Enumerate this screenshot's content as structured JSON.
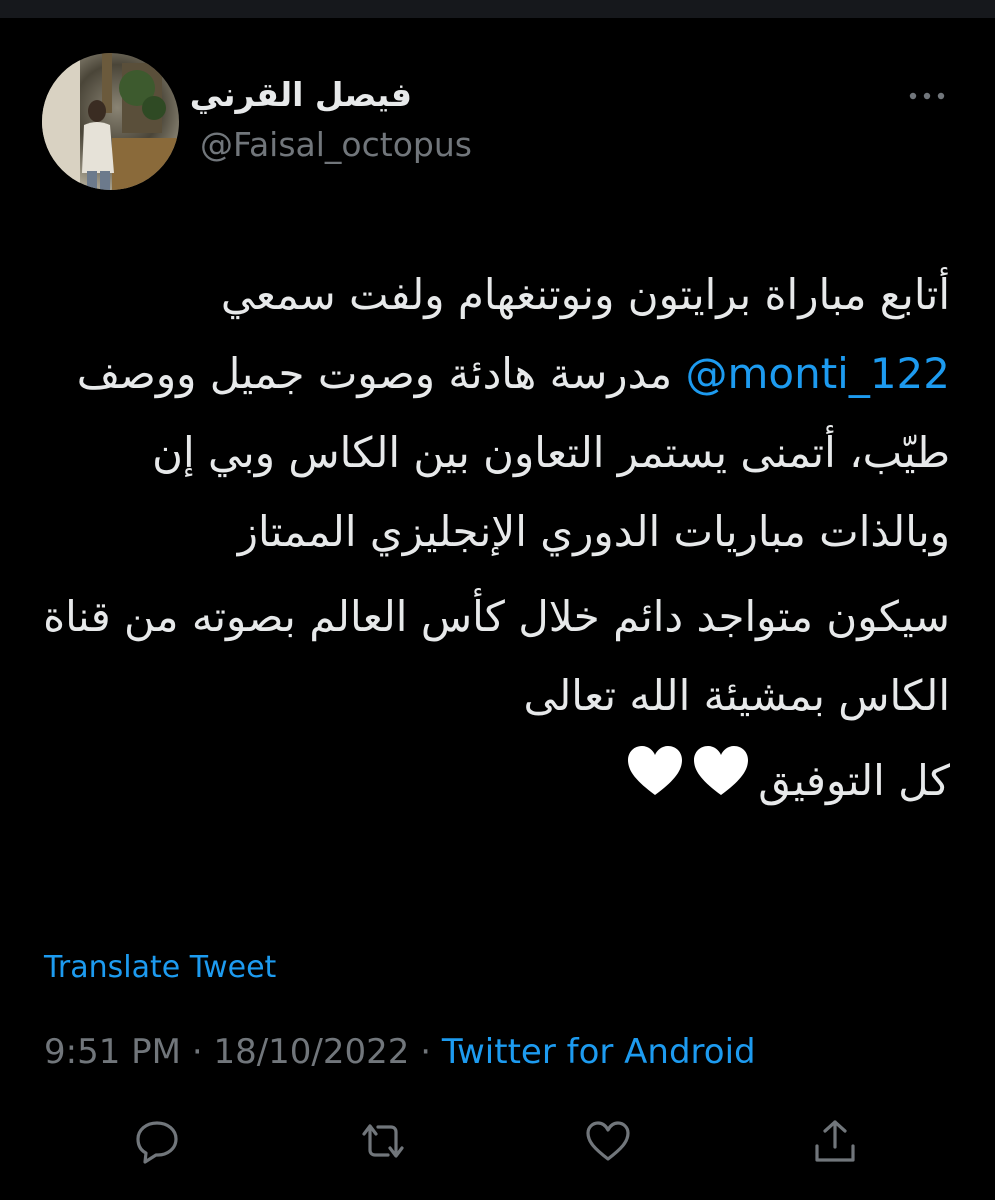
{
  "tweet": {
    "display_name": "فيصل القرني",
    "handle": "@Faisal_octopus",
    "paragraphs": [
      {
        "before_mention": "أتابع مباراة برايتون ونوتنغهام ولفت سمعي ",
        "mention": "@monti_122",
        "after_mention": " مدرسة هادئة وصوت جميل ووصف طيّب، أتمنى يستمر التعاون بين الكاس وبي إن وبالذات مباريات الدوري الإنجليزي الممتاز"
      },
      {
        "text": "سيكون متواجد دائم خلال كأس العالم بصوته من قناة الكاس بمشيئة الله تعالى"
      },
      {
        "text": "كل التوفيق"
      }
    ],
    "translate_label": "Translate Tweet",
    "time": "9:51 PM",
    "separator": "·",
    "date": "18/10/2022",
    "source": "Twitter for Android"
  },
  "icons": {
    "more": "more-horizontal-icon",
    "reply": "reply-icon",
    "retweet": "retweet-icon",
    "like": "heart-icon",
    "share": "share-icon",
    "emoji": "white-heart-emoji"
  },
  "colors": {
    "background": "#000000",
    "text": "#e7e9ea",
    "secondary": "#71767b",
    "link": "#1d9bf0"
  }
}
